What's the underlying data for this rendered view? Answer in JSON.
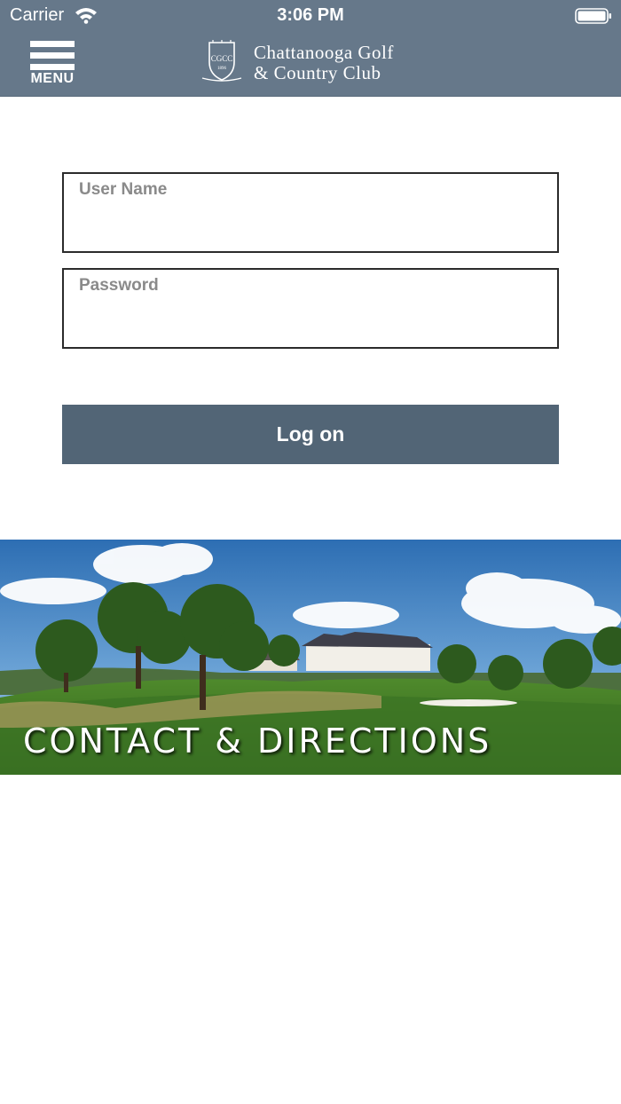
{
  "status_bar": {
    "carrier": "Carrier",
    "time": "3:06 PM"
  },
  "header": {
    "menu_label": "MENU",
    "club_name_line1": "Chattanooga Golf",
    "club_name_line2": "& Country Club",
    "crest_monogram": "CGCC",
    "crest_year": "1896",
    "background_color": "#66788a"
  },
  "login": {
    "username_placeholder": "User Name",
    "password_placeholder": "Password",
    "submit_label": "Log on",
    "button_color": "#526576"
  },
  "banner": {
    "title": "CONTACT & DIRECTIONS"
  },
  "icons": [
    "wifi-icon",
    "battery-icon",
    "hamburger-icon",
    "club-crest-logo"
  ]
}
